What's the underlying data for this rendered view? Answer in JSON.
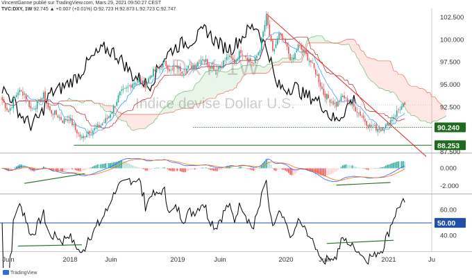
{
  "header": {
    "line1": "VincentGanne publié sur TradingView.com, Mars 29, 2021 09:50:27 CEST",
    "line2_symbol": "TVC:DXY, 1W",
    "line2_values": "92.745 ▲ +0.007 (+0.01%) O:92.723 H:92.873 L:92.723 C:92.747"
  },
  "footer": {
    "brand": "TradingView"
  },
  "chart_data": {
    "type": "candlestick",
    "watermark_symbol": "DXY, 1W",
    "watermark_name": "Indice devise Dollar U.S.",
    "x_ticks": [
      "Juin",
      "2018",
      "Juin",
      "2019",
      "Juin",
      "2020",
      "Juin",
      "2021",
      "Ju"
    ],
    "panels": [
      {
        "name": "price",
        "y_ticks": [
          "102.500",
          "100.000",
          "97.500",
          "95.000",
          "92.500",
          "87.500"
        ],
        "ylim": [
          87.5,
          103.5
        ],
        "levels": [
          {
            "label": "90.240",
            "value": 90.24,
            "color": "#1e6b1e"
          },
          {
            "label": "88.253",
            "value": 88.253,
            "color": "#1e6b1e"
          }
        ],
        "current_price": 92.747
      },
      {
        "name": "macd",
        "y_ticks": [
          "0.000",
          "-2.000"
        ],
        "ylim": [
          -2.7,
          1.6
        ]
      },
      {
        "name": "rsi",
        "y_ticks": [
          "60.00",
          "40.00"
        ],
        "ylim": [
          28,
          71
        ],
        "levels": [
          {
            "label": "50.00",
            "value": 50,
            "color": "#1f4fa8"
          }
        ]
      }
    ],
    "colors": {
      "up": "#26a69a",
      "down": "#ef5350",
      "trendline": "#e53935",
      "cloud_bull": "#4caf50",
      "cloud_bear": "#f44336",
      "overlay_line": "#000000",
      "support": "#1e6b1e",
      "rsi_level": "#1f4fa8"
    }
  }
}
